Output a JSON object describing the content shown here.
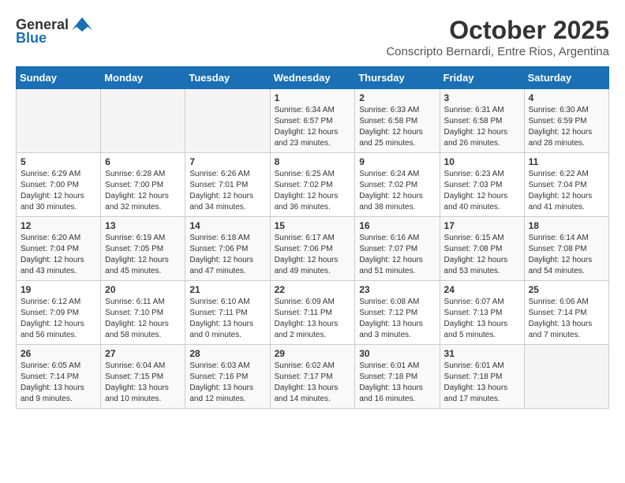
{
  "logo": {
    "general": "General",
    "blue": "Blue"
  },
  "title": "October 2025",
  "subtitle": "Conscripto Bernardi, Entre Rios, Argentina",
  "days_of_week": [
    "Sunday",
    "Monday",
    "Tuesday",
    "Wednesday",
    "Thursday",
    "Friday",
    "Saturday"
  ],
  "weeks": [
    [
      {
        "day": "",
        "info": ""
      },
      {
        "day": "",
        "info": ""
      },
      {
        "day": "",
        "info": ""
      },
      {
        "day": "1",
        "info": "Sunrise: 6:34 AM\nSunset: 6:57 PM\nDaylight: 12 hours\nand 23 minutes."
      },
      {
        "day": "2",
        "info": "Sunrise: 6:33 AM\nSunset: 6:58 PM\nDaylight: 12 hours\nand 25 minutes."
      },
      {
        "day": "3",
        "info": "Sunrise: 6:31 AM\nSunset: 6:58 PM\nDaylight: 12 hours\nand 26 minutes."
      },
      {
        "day": "4",
        "info": "Sunrise: 6:30 AM\nSunset: 6:59 PM\nDaylight: 12 hours\nand 28 minutes."
      }
    ],
    [
      {
        "day": "5",
        "info": "Sunrise: 6:29 AM\nSunset: 7:00 PM\nDaylight: 12 hours\nand 30 minutes."
      },
      {
        "day": "6",
        "info": "Sunrise: 6:28 AM\nSunset: 7:00 PM\nDaylight: 12 hours\nand 32 minutes."
      },
      {
        "day": "7",
        "info": "Sunrise: 6:26 AM\nSunset: 7:01 PM\nDaylight: 12 hours\nand 34 minutes."
      },
      {
        "day": "8",
        "info": "Sunrise: 6:25 AM\nSunset: 7:02 PM\nDaylight: 12 hours\nand 36 minutes."
      },
      {
        "day": "9",
        "info": "Sunrise: 6:24 AM\nSunset: 7:02 PM\nDaylight: 12 hours\nand 38 minutes."
      },
      {
        "day": "10",
        "info": "Sunrise: 6:23 AM\nSunset: 7:03 PM\nDaylight: 12 hours\nand 40 minutes."
      },
      {
        "day": "11",
        "info": "Sunrise: 6:22 AM\nSunset: 7:04 PM\nDaylight: 12 hours\nand 41 minutes."
      }
    ],
    [
      {
        "day": "12",
        "info": "Sunrise: 6:20 AM\nSunset: 7:04 PM\nDaylight: 12 hours\nand 43 minutes."
      },
      {
        "day": "13",
        "info": "Sunrise: 6:19 AM\nSunset: 7:05 PM\nDaylight: 12 hours\nand 45 minutes."
      },
      {
        "day": "14",
        "info": "Sunrise: 6:18 AM\nSunset: 7:06 PM\nDaylight: 12 hours\nand 47 minutes."
      },
      {
        "day": "15",
        "info": "Sunrise: 6:17 AM\nSunset: 7:06 PM\nDaylight: 12 hours\nand 49 minutes."
      },
      {
        "day": "16",
        "info": "Sunrise: 6:16 AM\nSunset: 7:07 PM\nDaylight: 12 hours\nand 51 minutes."
      },
      {
        "day": "17",
        "info": "Sunrise: 6:15 AM\nSunset: 7:08 PM\nDaylight: 12 hours\nand 53 minutes."
      },
      {
        "day": "18",
        "info": "Sunrise: 6:14 AM\nSunset: 7:08 PM\nDaylight: 12 hours\nand 54 minutes."
      }
    ],
    [
      {
        "day": "19",
        "info": "Sunrise: 6:12 AM\nSunset: 7:09 PM\nDaylight: 12 hours\nand 56 minutes."
      },
      {
        "day": "20",
        "info": "Sunrise: 6:11 AM\nSunset: 7:10 PM\nDaylight: 12 hours\nand 58 minutes."
      },
      {
        "day": "21",
        "info": "Sunrise: 6:10 AM\nSunset: 7:11 PM\nDaylight: 13 hours\nand 0 minutes."
      },
      {
        "day": "22",
        "info": "Sunrise: 6:09 AM\nSunset: 7:11 PM\nDaylight: 13 hours\nand 2 minutes."
      },
      {
        "day": "23",
        "info": "Sunrise: 6:08 AM\nSunset: 7:12 PM\nDaylight: 13 hours\nand 3 minutes."
      },
      {
        "day": "24",
        "info": "Sunrise: 6:07 AM\nSunset: 7:13 PM\nDaylight: 13 hours\nand 5 minutes."
      },
      {
        "day": "25",
        "info": "Sunrise: 6:06 AM\nSunset: 7:14 PM\nDaylight: 13 hours\nand 7 minutes."
      }
    ],
    [
      {
        "day": "26",
        "info": "Sunrise: 6:05 AM\nSunset: 7:14 PM\nDaylight: 13 hours\nand 9 minutes."
      },
      {
        "day": "27",
        "info": "Sunrise: 6:04 AM\nSunset: 7:15 PM\nDaylight: 13 hours\nand 10 minutes."
      },
      {
        "day": "28",
        "info": "Sunrise: 6:03 AM\nSunset: 7:16 PM\nDaylight: 13 hours\nand 12 minutes."
      },
      {
        "day": "29",
        "info": "Sunrise: 6:02 AM\nSunset: 7:17 PM\nDaylight: 13 hours\nand 14 minutes."
      },
      {
        "day": "30",
        "info": "Sunrise: 6:01 AM\nSunset: 7:18 PM\nDaylight: 13 hours\nand 16 minutes."
      },
      {
        "day": "31",
        "info": "Sunrise: 6:01 AM\nSunset: 7:18 PM\nDaylight: 13 hours\nand 17 minutes."
      },
      {
        "day": "",
        "info": ""
      }
    ]
  ]
}
